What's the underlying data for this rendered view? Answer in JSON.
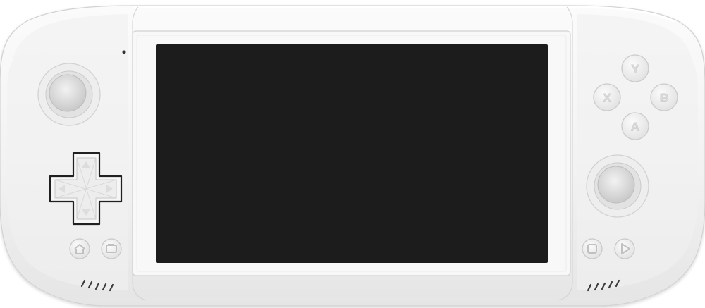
{
  "device": {
    "name": "handheld-game-console",
    "colors": {
      "shell": "#f1f1f1",
      "shell_shadow": "#d7d7d7",
      "screen_bezel": "#f7f7f7",
      "screen": "#1c1c1c",
      "button_face": "#ececec",
      "button_label": "#d9d9d9"
    }
  },
  "face_buttons": {
    "y": "Y",
    "x": "X",
    "b": "B",
    "a": "A"
  },
  "icons": {
    "home": "home-icon",
    "back": "back-icon",
    "stop": "stop-icon",
    "play": "play-icon"
  },
  "screen": {
    "state": "off"
  }
}
